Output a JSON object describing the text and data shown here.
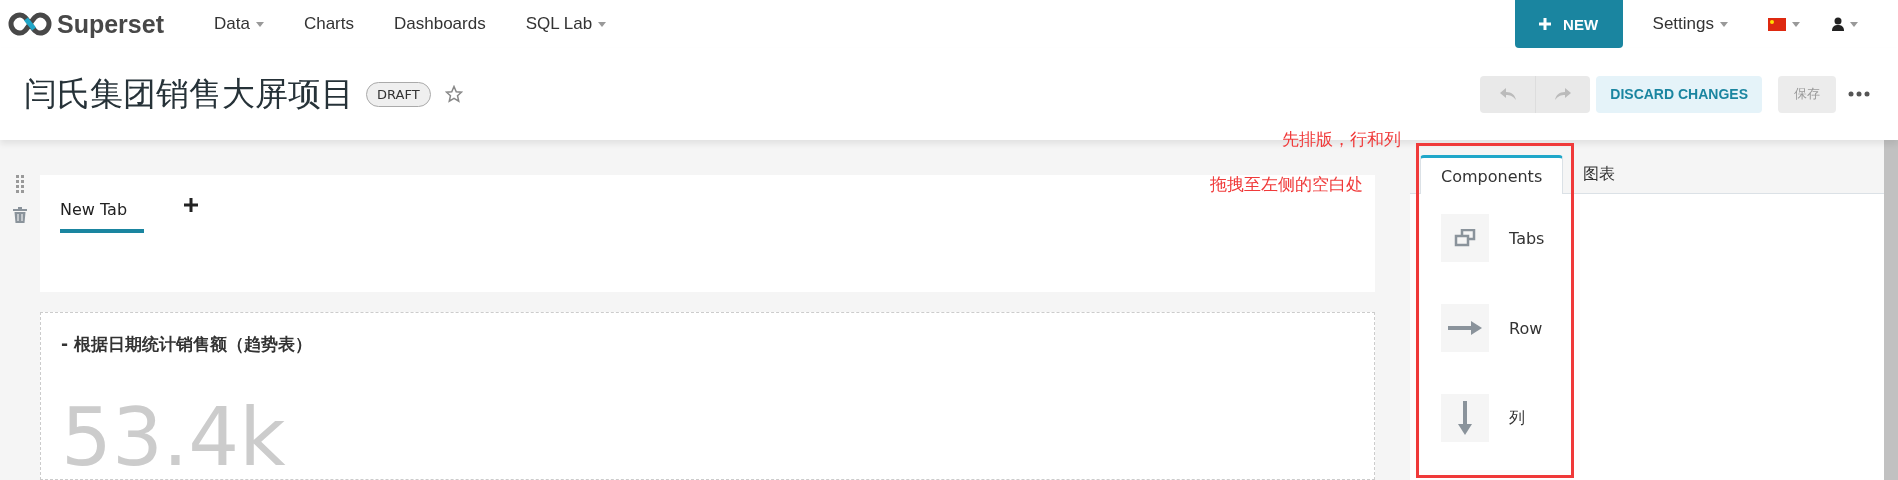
{
  "navbar": {
    "brand": "Superset",
    "menu": [
      {
        "label": "Data",
        "dropdown": true
      },
      {
        "label": "Charts",
        "dropdown": false
      },
      {
        "label": "Dashboards",
        "dropdown": false
      },
      {
        "label": "SQL Lab",
        "dropdown": true
      }
    ],
    "new_button": "NEW",
    "settings": "Settings"
  },
  "header": {
    "title": "闫氏集团销售大屏项目",
    "badge": "DRAFT",
    "starred": false,
    "undo_disabled": true,
    "redo_disabled": true,
    "discard": "DISCARD CHANGES",
    "save": "保存",
    "save_disabled": true
  },
  "dashboard": {
    "tabs": [
      {
        "label": "New Tab",
        "selected": true
      }
    ],
    "chart": {
      "title": "- 根据日期统计销售额（趋势表）",
      "big_number": "53.4k"
    }
  },
  "builder": {
    "tabs": [
      {
        "label": "Components",
        "selected": true
      },
      {
        "label": "图表",
        "selected": false
      }
    ],
    "components": [
      {
        "kind": "tabs",
        "label": "Tabs"
      },
      {
        "kind": "row",
        "label": "Row"
      },
      {
        "kind": "column",
        "label": "列"
      }
    ]
  },
  "annotations": [
    "先排版，行和列",
    "拖拽至左侧的空白处"
  ]
}
